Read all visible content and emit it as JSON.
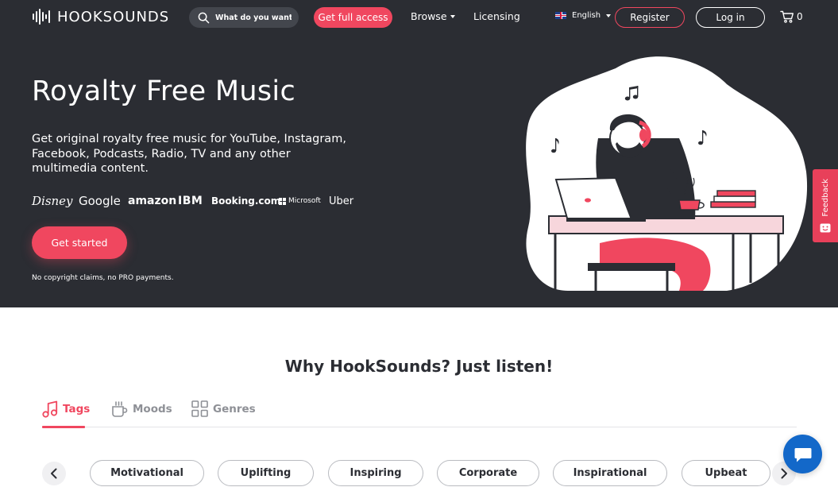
{
  "colors": {
    "hero_bg": "#2b2d33",
    "accent": "#f0475f",
    "chat_blue": "#1368c9"
  },
  "nav": {
    "logo_text": "HOOKSOUNDS",
    "search_placeholder": "What do you want to",
    "full_access_label": "Get full access",
    "browse_label": "Browse",
    "licensing_label": "Licensing",
    "language_label": "English",
    "register_label": "Register",
    "login_label": "Log in",
    "cart_count": "0"
  },
  "hero": {
    "title": "Royalty Free Music",
    "subtitle": "Get original royalty free music for YouTube, Instagram, Facebook, Podcasts, Radio, TV and any other multimedia content.",
    "brands": [
      "Disney",
      "Google",
      "amazon",
      "IBM",
      "Booking.com",
      "Microsoft",
      "Uber"
    ],
    "cta_label": "Get started",
    "note": "No copyright claims, no PRO payments."
  },
  "feedback_label": "Feedback",
  "section": {
    "title": "Why HookSounds? Just listen!",
    "tabs": [
      {
        "label": "Tags",
        "icon": "music-note-icon",
        "active": true
      },
      {
        "label": "Moods",
        "icon": "mug-icon",
        "active": false
      },
      {
        "label": "Genres",
        "icon": "grid-icon",
        "active": false
      }
    ],
    "chips": [
      "Motivational",
      "Uplifting",
      "Inspiring",
      "Corporate",
      "Inspirational",
      "Upbeat"
    ]
  }
}
